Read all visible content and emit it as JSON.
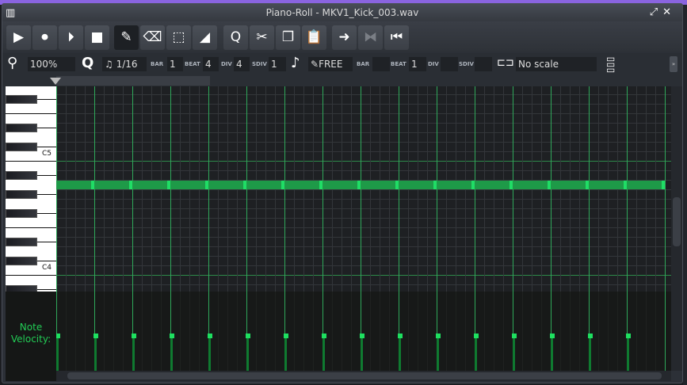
{
  "window": {
    "title": "Piano-Roll - MKV1_Kick_003.wav"
  },
  "toolbar": [
    {
      "name": "play-button",
      "icon": "▶"
    },
    {
      "name": "record-button",
      "icon": "⏺"
    },
    {
      "name": "record-while-playing-button",
      "icon": "⏵"
    },
    {
      "name": "stop-button",
      "icon": "■"
    },
    {
      "name": "draw-mode-button",
      "icon": "✎",
      "active": true
    },
    {
      "name": "erase-mode-button",
      "icon": "⌫"
    },
    {
      "name": "select-mode-button",
      "icon": "⬚"
    },
    {
      "name": "pitch-bend-mode-button",
      "icon": "◢"
    },
    {
      "name": "quantize-button",
      "icon": "Q"
    },
    {
      "name": "cut-button",
      "icon": "✂"
    },
    {
      "name": "copy-button",
      "icon": "❐"
    },
    {
      "name": "paste-button",
      "icon": "📋"
    },
    {
      "name": "stop-behaviour-button",
      "icon": "➜"
    },
    {
      "name": "loop-button",
      "icon": "⧓",
      "disabled": true
    },
    {
      "name": "rewind-button",
      "icon": "⏮"
    }
  ],
  "controls": {
    "zoom": "100%",
    "quantize": "1/16",
    "length": {
      "bar_label": "BAR",
      "bar": "1",
      "beat_label": "BEAT",
      "beat": "4",
      "div_label": "DIV",
      "div": "4",
      "sdiv_label": "SDIV",
      "sdiv": "1"
    },
    "note_length": "FREE",
    "pos": {
      "bar_label": "BAR",
      "bar": "",
      "beat_label": "BEAT",
      "beat": "1",
      "div_label": "DIV",
      "div": "",
      "sdiv_label": "SDIV",
      "sdiv": ""
    },
    "scale": "No scale"
  },
  "keyboard": {
    "labels": {
      "c5": "C5",
      "c4": "C4"
    }
  },
  "notes": {
    "pitch": "A4",
    "count": 16,
    "length_steps": 4,
    "velocity_percent": 50,
    "color": "#1e9a48"
  },
  "velocity_label": "Note Velocity:"
}
